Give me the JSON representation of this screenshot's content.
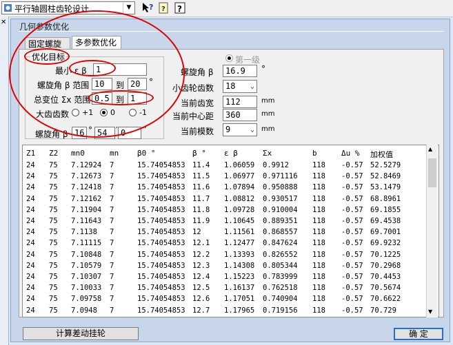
{
  "toolbar": {
    "module_select": "平行轴圆柱齿轮设计",
    "help_label": "?"
  },
  "window": {
    "title": "几何参数优化"
  },
  "tabs": [
    {
      "label": "固定螺旋角"
    },
    {
      "label": "多参数优化"
    }
  ],
  "form": {
    "group_label": "优化目标",
    "min_label": "最小 ε β",
    "min_value": "1",
    "helix_range_label": "螺旋角 β 范围",
    "helix_from": "10",
    "helix_to_label": "到",
    "helix_to": "20",
    "helix_unit": "°",
    "shift_range_label": "总变位 Σx 范围",
    "shift_from": "0.5",
    "shift_to_label": "到",
    "shift_to": "1",
    "big_gear_label": "大齿齿数",
    "radio_plus": "+1",
    "radio_zero": "0",
    "radio_minus": "-1",
    "helix_dms_label": "螺旋角 β",
    "helix_deg": "16",
    "helix_min": "54",
    "helix_sec": "0",
    "deg_sym": "°",
    "min_sym": "′",
    "sec_sym": "″"
  },
  "right_form": {
    "stage_label": "第一级",
    "helix_label": "螺旋角 β",
    "helix_value": "16.9",
    "helix_unit": "°",
    "pinion_teeth_label": "小齿轮齿数",
    "pinion_teeth_value": "18",
    "face_width_label": "当前齿宽",
    "face_width_value": "112",
    "face_width_unit": "mm",
    "center_dist_label": "当前中心距",
    "center_dist_value": "360",
    "center_dist_unit": "mm",
    "module_label": "当前模数",
    "module_value": "9",
    "module_unit": "mm"
  },
  "table": {
    "headers": [
      "Z1",
      "Z2",
      "mn0",
      "mn",
      "β0 °",
      "β °",
      "ε β",
      "Σx",
      "b",
      "Δu %",
      "加权值"
    ],
    "rows": [
      [
        "24",
        "75",
        "7.12924",
        "7",
        "15.74054853",
        "11.4",
        "1.06059",
        "0.9912",
        "118",
        "-0.57",
        "52.5279"
      ],
      [
        "24",
        "75",
        "7.12673",
        "7",
        "15.74054853",
        "11.5",
        "1.06977",
        "0.971116",
        "118",
        "-0.57",
        "52.8469"
      ],
      [
        "24",
        "75",
        "7.12418",
        "7",
        "15.74054853",
        "11.6",
        "1.07894",
        "0.950888",
        "118",
        "-0.57",
        "53.1479"
      ],
      [
        "24",
        "75",
        "7.12162",
        "7",
        "15.74054853",
        "11.7",
        "1.08812",
        "0.930517",
        "118",
        "-0.57",
        "68.8961"
      ],
      [
        "24",
        "75",
        "7.11904",
        "7",
        "15.74054853",
        "11.8",
        "1.09728",
        "0.910004",
        "118",
        "-0.57",
        "69.1855"
      ],
      [
        "24",
        "75",
        "7.11643",
        "7",
        "15.74054853",
        "11.9",
        "1.10645",
        "0.889351",
        "118",
        "-0.57",
        "69.4538"
      ],
      [
        "24",
        "75",
        "7.1138",
        "7",
        "15.74054853",
        "12",
        "1.11561",
        "0.868557",
        "118",
        "-0.57",
        "69.7001"
      ],
      [
        "24",
        "75",
        "7.11115",
        "7",
        "15.74054853",
        "12.1",
        "1.12477",
        "0.847624",
        "118",
        "-0.57",
        "69.9232"
      ],
      [
        "24",
        "75",
        "7.10848",
        "7",
        "15.74054853",
        "12.2",
        "1.13393",
        "0.826552",
        "118",
        "-0.57",
        "70.1225"
      ],
      [
        "24",
        "75",
        "7.10579",
        "7",
        "15.74054853",
        "12.3",
        "1.14308",
        "0.805344",
        "118",
        "-0.57",
        "70.2968"
      ],
      [
        "24",
        "75",
        "7.10307",
        "7",
        "15.74054853",
        "12.4",
        "1.15223",
        "0.783999",
        "118",
        "-0.57",
        "70.4453"
      ],
      [
        "24",
        "75",
        "7.10033",
        "7",
        "15.74054853",
        "12.5",
        "1.16137",
        "0.762518",
        "118",
        "-0.57",
        "70.5674"
      ],
      [
        "24",
        "75",
        "7.09758",
        "7",
        "15.74054853",
        "12.6",
        "1.17051",
        "0.740904",
        "118",
        "-0.57",
        "70.6622"
      ],
      [
        "24",
        "75",
        "7.0948",
        "7",
        "15.74054853",
        "12.7",
        "1.17965",
        "0.719156",
        "118",
        "-0.57",
        "70.729"
      ]
    ]
  },
  "buttons": {
    "calc_label": "计算差动挂轮",
    "ok_label": "确  定"
  }
}
